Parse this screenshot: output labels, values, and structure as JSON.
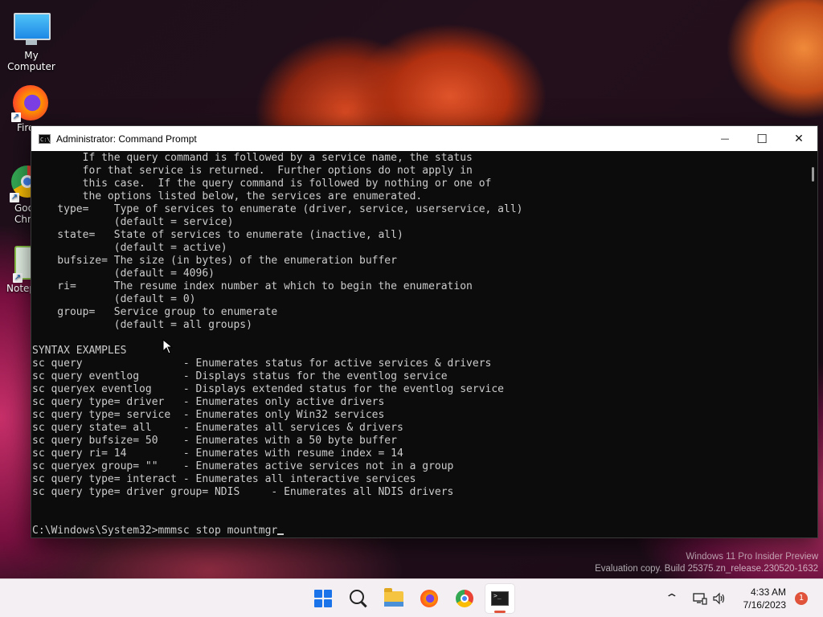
{
  "desktop": {
    "icons": [
      {
        "label": "My Computer",
        "icon": "computer-icon"
      },
      {
        "label": "Fire",
        "icon": "firefox-icon"
      },
      {
        "label": "Goo\nChro",
        "icon": "chrome-icon"
      },
      {
        "label": "Notep",
        "icon": "notepad-icon"
      }
    ],
    "watermark": {
      "line1": "Windows 11 Pro Insider Preview",
      "line2": "Evaluation copy. Build 25375.zn_release.230520-1632"
    }
  },
  "window": {
    "title": "Administrator: Command Prompt",
    "icon_text": "C:\\_",
    "buttons": {
      "minimize": "—",
      "maximize": "☐",
      "close": "✕"
    }
  },
  "console": {
    "lines": [
      "        If the query command is followed by a service name, the status",
      "        for that service is returned.  Further options do not apply in",
      "        this case.  If the query command is followed by nothing or one of",
      "        the options listed below, the services are enumerated.",
      "    type=    Type of services to enumerate (driver, service, userservice, all)",
      "             (default = service)",
      "    state=   State of services to enumerate (inactive, all)",
      "             (default = active)",
      "    bufsize= The size (in bytes) of the enumeration buffer",
      "             (default = 4096)",
      "    ri=      The resume index number at which to begin the enumeration",
      "             (default = 0)",
      "    group=   Service group to enumerate",
      "             (default = all groups)",
      "",
      "SYNTAX EXAMPLES",
      "sc query                - Enumerates status for active services & drivers",
      "sc query eventlog       - Displays status for the eventlog service",
      "sc queryex eventlog     - Displays extended status for the eventlog service",
      "sc query type= driver   - Enumerates only active drivers",
      "sc query type= service  - Enumerates only Win32 services",
      "sc query state= all     - Enumerates all services & drivers",
      "sc query bufsize= 50    - Enumerates with a 50 byte buffer",
      "sc query ri= 14         - Enumerates with resume index = 14",
      "sc queryex group= \"\"    - Enumerates active services not in a group",
      "sc query type= interact - Enumerates all interactive services",
      "sc query type= driver group= NDIS     - Enumerates all NDIS drivers",
      "",
      ""
    ],
    "prompt": "C:\\Windows\\System32>mmmsc stop mountmgr"
  },
  "taskbar": {
    "apps": [
      {
        "name": "start-button",
        "icon": "windows-start-icon"
      },
      {
        "name": "search-button",
        "icon": "search-icon"
      },
      {
        "name": "file-explorer-button",
        "icon": "folder-icon"
      },
      {
        "name": "firefox-taskbar-button",
        "icon": "firefox-icon"
      },
      {
        "name": "chrome-taskbar-button",
        "icon": "chrome-icon"
      },
      {
        "name": "terminal-taskbar-button",
        "icon": "terminal-icon",
        "active": true
      }
    ],
    "tray": {
      "chevron": "^",
      "time": "4:33 AM",
      "date": "7/16/2023",
      "notifications": "1"
    }
  }
}
